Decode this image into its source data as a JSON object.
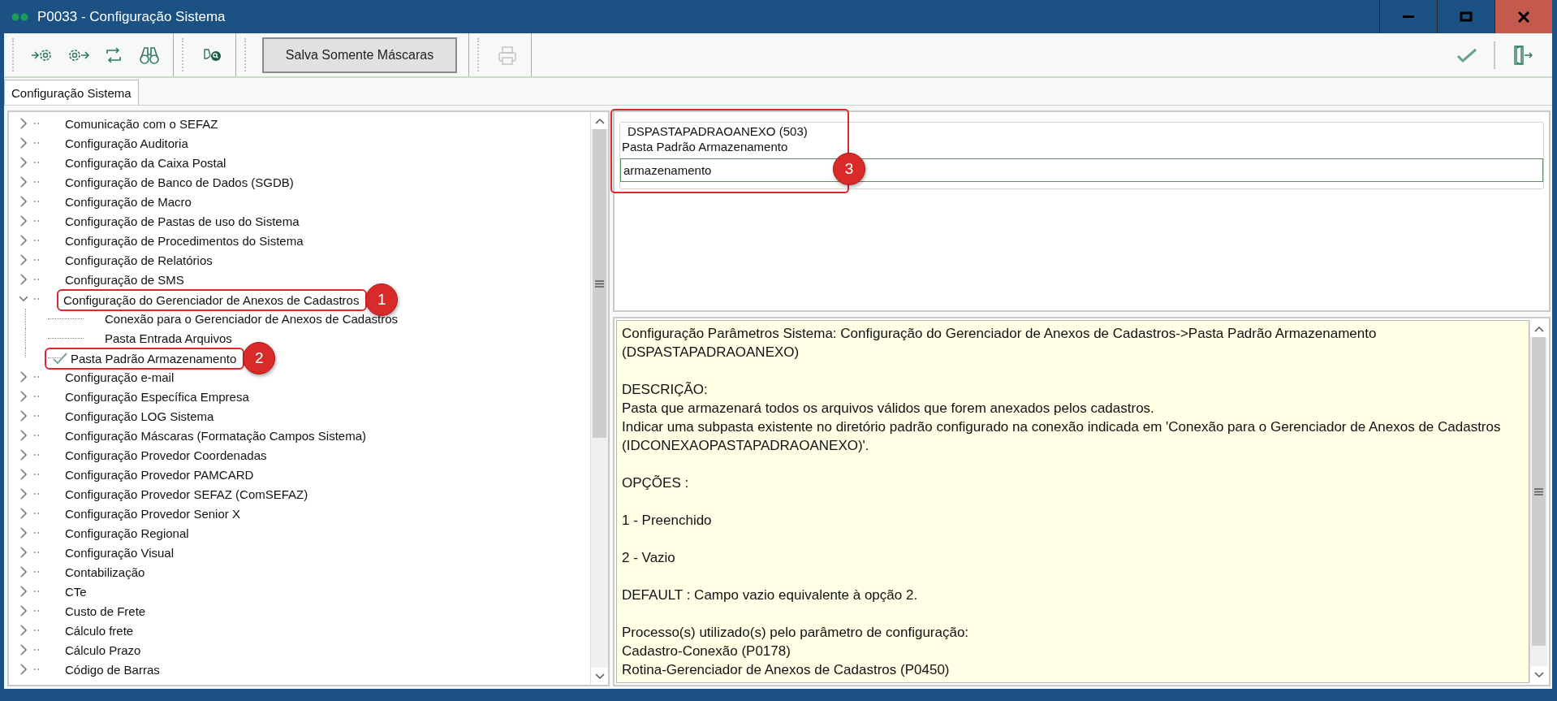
{
  "window": {
    "title": "P0033 - Configuração Sistema"
  },
  "toolbar": {
    "groups": [
      {
        "tools": [
          {
            "kind": "icon",
            "disabled": false
          },
          {
            "kind": "icon",
            "disabled": false
          },
          {
            "kind": "icon",
            "disabled": false
          },
          {
            "kind": "icon",
            "disabled": false
          }
        ]
      },
      {
        "tools": [
          {
            "kind": "icon",
            "disabled": false
          }
        ]
      },
      {
        "tools": [
          {
            "kind": "button",
            "label": "Salva Somente Máscaras",
            "disabled": false
          }
        ]
      },
      {
        "tools": [
          {
            "kind": "icon",
            "disabled": true
          }
        ]
      }
    ],
    "right_tools": [
      {
        "kind": "icon",
        "disabled": false
      },
      {
        "kind": "icon",
        "disabled": false
      }
    ]
  },
  "tabs": [
    {
      "label": "Configuração Sistema",
      "selected": true
    }
  ],
  "tree": {
    "items": [
      {
        "label": "Comunicação com o SEFAZ",
        "expanded": false,
        "selected": false
      },
      {
        "label": "Configuração Auditoria",
        "expanded": false,
        "selected": false
      },
      {
        "label": "Configuração da Caixa Postal",
        "expanded": false,
        "selected": false
      },
      {
        "label": "Configuração de Banco de Dados (SGDB)",
        "expanded": false,
        "selected": false
      },
      {
        "label": "Configuração de Macro",
        "expanded": false,
        "selected": false
      },
      {
        "label": "Configuração de Pastas de uso do Sistema",
        "expanded": false,
        "selected": false
      },
      {
        "label": "Configuração de Procedimentos do Sistema",
        "expanded": false,
        "selected": false
      },
      {
        "label": "Configuração de Relatórios",
        "expanded": false,
        "selected": false
      },
      {
        "label": "Configuração de SMS",
        "expanded": false,
        "selected": false
      },
      {
        "label": "Configuração do Gerenciador de Anexos de Cadastros",
        "expanded": true,
        "selected": false,
        "callout": "1",
        "children": [
          {
            "label": "Conexão para o Gerenciador de Anexos de Cadastros",
            "selected": false
          },
          {
            "label": "Pasta Entrada Arquivos",
            "selected": false
          },
          {
            "label": "Pasta Padrão Armazenamento",
            "selected": true,
            "callout": "2"
          }
        ]
      },
      {
        "label": "Configuração e-mail",
        "expanded": false,
        "selected": false
      },
      {
        "label": "Configuração Específica Empresa",
        "expanded": false,
        "selected": false
      },
      {
        "label": "Configuração LOG Sistema",
        "expanded": false,
        "selected": false
      },
      {
        "label": "Configuração Máscaras (Formatação Campos Sistema)",
        "expanded": false,
        "selected": false
      },
      {
        "label": "Configuração Provedor Coordenadas",
        "expanded": false,
        "selected": false
      },
      {
        "label": "Configuração Provedor PAMCARD",
        "expanded": false,
        "selected": false
      },
      {
        "label": "Configuração Provedor SEFAZ (ComSEFAZ)",
        "expanded": false,
        "selected": false
      },
      {
        "label": "Configuração Provedor Senior X",
        "expanded": false,
        "selected": false
      },
      {
        "label": "Configuração Regional",
        "expanded": false,
        "selected": false
      },
      {
        "label": "Configuração Visual",
        "expanded": false,
        "selected": false
      },
      {
        "label": "Contabilização",
        "expanded": false,
        "selected": false
      },
      {
        "label": "CTe",
        "expanded": false,
        "selected": false
      },
      {
        "label": "Custo de Frete",
        "expanded": false,
        "selected": false
      },
      {
        "label": "Cálculo frete",
        "expanded": false,
        "selected": false
      },
      {
        "label": "Cálculo Prazo",
        "expanded": false,
        "selected": false
      },
      {
        "label": "Código de Barras",
        "expanded": false,
        "selected": false
      }
    ]
  },
  "parameter": {
    "legend": "DSPASTAPADRAOANEXO (503)",
    "label": "Pasta Padrão Armazenamento",
    "value": "armazenamento",
    "callout": "3"
  },
  "description": {
    "paragraphs": [
      [
        "Configuração Parâmetros Sistema: Configuração do Gerenciador de Anexos de Cadastros->Pasta Padrão Armazenamento (DSPASTAPADRAOANEXO)"
      ],
      [
        "DESCRIÇÃO:",
        "Pasta que armazenará todos os arquivos válidos que forem anexados pelos cadastros.",
        "Indicar uma subpasta existente no diretório padrão configurado na conexão indicada em 'Conexão para o Gerenciador de Anexos de Cadastros (IDCONEXAOPASTAPADRAOANEXO)'."
      ],
      [
        "OPÇÕES :"
      ],
      [
        "1 - Preenchido"
      ],
      [
        "2 - Vazio"
      ],
      [
        "DEFAULT : Campo vazio equivalente à opção 2."
      ],
      [
        "Processo(s) utilizado(s) pelo parâmetro de configuração:",
        "Cadastro-Conexão (P0178)",
        "Rotina-Gerenciador de Anexos de Cadastros (P0450)"
      ]
    ]
  }
}
